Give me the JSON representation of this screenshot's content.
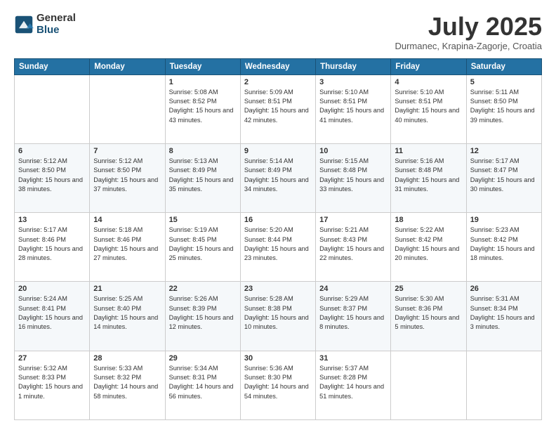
{
  "header": {
    "logo_general": "General",
    "logo_blue": "Blue",
    "month_title": "July 2025",
    "location": "Durmanec, Krapina-Zagorje, Croatia"
  },
  "days_of_week": [
    "Sunday",
    "Monday",
    "Tuesday",
    "Wednesday",
    "Thursday",
    "Friday",
    "Saturday"
  ],
  "weeks": [
    [
      {
        "day": "",
        "info": ""
      },
      {
        "day": "",
        "info": ""
      },
      {
        "day": "1",
        "info": "Sunrise: 5:08 AM\nSunset: 8:52 PM\nDaylight: 15 hours and 43 minutes."
      },
      {
        "day": "2",
        "info": "Sunrise: 5:09 AM\nSunset: 8:51 PM\nDaylight: 15 hours and 42 minutes."
      },
      {
        "day": "3",
        "info": "Sunrise: 5:10 AM\nSunset: 8:51 PM\nDaylight: 15 hours and 41 minutes."
      },
      {
        "day": "4",
        "info": "Sunrise: 5:10 AM\nSunset: 8:51 PM\nDaylight: 15 hours and 40 minutes."
      },
      {
        "day": "5",
        "info": "Sunrise: 5:11 AM\nSunset: 8:50 PM\nDaylight: 15 hours and 39 minutes."
      }
    ],
    [
      {
        "day": "6",
        "info": "Sunrise: 5:12 AM\nSunset: 8:50 PM\nDaylight: 15 hours and 38 minutes."
      },
      {
        "day": "7",
        "info": "Sunrise: 5:12 AM\nSunset: 8:50 PM\nDaylight: 15 hours and 37 minutes."
      },
      {
        "day": "8",
        "info": "Sunrise: 5:13 AM\nSunset: 8:49 PM\nDaylight: 15 hours and 35 minutes."
      },
      {
        "day": "9",
        "info": "Sunrise: 5:14 AM\nSunset: 8:49 PM\nDaylight: 15 hours and 34 minutes."
      },
      {
        "day": "10",
        "info": "Sunrise: 5:15 AM\nSunset: 8:48 PM\nDaylight: 15 hours and 33 minutes."
      },
      {
        "day": "11",
        "info": "Sunrise: 5:16 AM\nSunset: 8:48 PM\nDaylight: 15 hours and 31 minutes."
      },
      {
        "day": "12",
        "info": "Sunrise: 5:17 AM\nSunset: 8:47 PM\nDaylight: 15 hours and 30 minutes."
      }
    ],
    [
      {
        "day": "13",
        "info": "Sunrise: 5:17 AM\nSunset: 8:46 PM\nDaylight: 15 hours and 28 minutes."
      },
      {
        "day": "14",
        "info": "Sunrise: 5:18 AM\nSunset: 8:46 PM\nDaylight: 15 hours and 27 minutes."
      },
      {
        "day": "15",
        "info": "Sunrise: 5:19 AM\nSunset: 8:45 PM\nDaylight: 15 hours and 25 minutes."
      },
      {
        "day": "16",
        "info": "Sunrise: 5:20 AM\nSunset: 8:44 PM\nDaylight: 15 hours and 23 minutes."
      },
      {
        "day": "17",
        "info": "Sunrise: 5:21 AM\nSunset: 8:43 PM\nDaylight: 15 hours and 22 minutes."
      },
      {
        "day": "18",
        "info": "Sunrise: 5:22 AM\nSunset: 8:42 PM\nDaylight: 15 hours and 20 minutes."
      },
      {
        "day": "19",
        "info": "Sunrise: 5:23 AM\nSunset: 8:42 PM\nDaylight: 15 hours and 18 minutes."
      }
    ],
    [
      {
        "day": "20",
        "info": "Sunrise: 5:24 AM\nSunset: 8:41 PM\nDaylight: 15 hours and 16 minutes."
      },
      {
        "day": "21",
        "info": "Sunrise: 5:25 AM\nSunset: 8:40 PM\nDaylight: 15 hours and 14 minutes."
      },
      {
        "day": "22",
        "info": "Sunrise: 5:26 AM\nSunset: 8:39 PM\nDaylight: 15 hours and 12 minutes."
      },
      {
        "day": "23",
        "info": "Sunrise: 5:28 AM\nSunset: 8:38 PM\nDaylight: 15 hours and 10 minutes."
      },
      {
        "day": "24",
        "info": "Sunrise: 5:29 AM\nSunset: 8:37 PM\nDaylight: 15 hours and 8 minutes."
      },
      {
        "day": "25",
        "info": "Sunrise: 5:30 AM\nSunset: 8:36 PM\nDaylight: 15 hours and 5 minutes."
      },
      {
        "day": "26",
        "info": "Sunrise: 5:31 AM\nSunset: 8:34 PM\nDaylight: 15 hours and 3 minutes."
      }
    ],
    [
      {
        "day": "27",
        "info": "Sunrise: 5:32 AM\nSunset: 8:33 PM\nDaylight: 15 hours and 1 minute."
      },
      {
        "day": "28",
        "info": "Sunrise: 5:33 AM\nSunset: 8:32 PM\nDaylight: 14 hours and 58 minutes."
      },
      {
        "day": "29",
        "info": "Sunrise: 5:34 AM\nSunset: 8:31 PM\nDaylight: 14 hours and 56 minutes."
      },
      {
        "day": "30",
        "info": "Sunrise: 5:36 AM\nSunset: 8:30 PM\nDaylight: 14 hours and 54 minutes."
      },
      {
        "day": "31",
        "info": "Sunrise: 5:37 AM\nSunset: 8:28 PM\nDaylight: 14 hours and 51 minutes."
      },
      {
        "day": "",
        "info": ""
      },
      {
        "day": "",
        "info": ""
      }
    ]
  ]
}
